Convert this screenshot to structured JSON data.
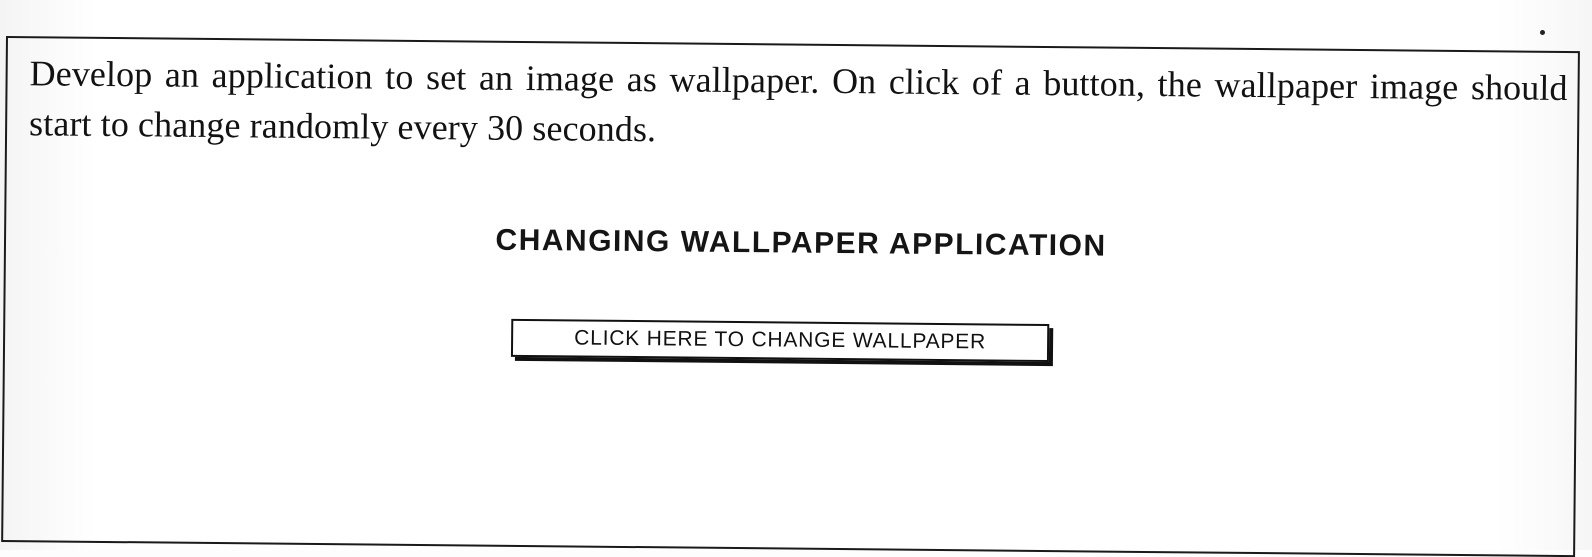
{
  "problem": {
    "text": "Develop an application to set an image as wallpaper. On click of a button, the wallpaper image should start to change randomly every 30 seconds."
  },
  "app": {
    "title": "CHANGING WALLPAPER APPLICATION",
    "button_label": "CLICK HERE TO CHANGE WALLPAPER"
  }
}
